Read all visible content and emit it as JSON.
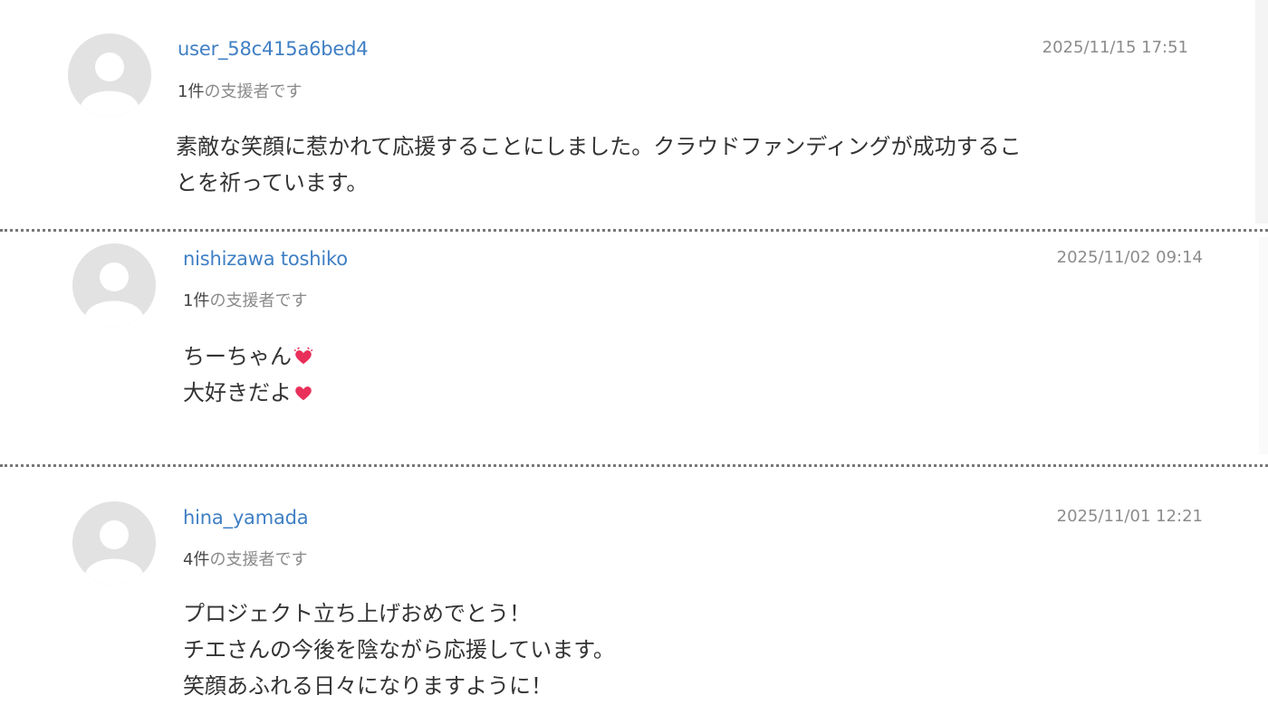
{
  "comments": [
    {
      "username": "user_58c415a6bed4",
      "supporter_count": "1件",
      "supporter_suffix": "の支援者です",
      "timestamp": "2025/11/15 17:51",
      "lines": [
        "素敵な笑顔に惹かれて応援することにしました。クラウドファンディングが成功するこ",
        "とを祈っています。"
      ]
    },
    {
      "username": "nishizawa toshiko",
      "supporter_count": "1件",
      "supporter_suffix": "の支援者です",
      "timestamp": "2025/11/02 09:14",
      "lines": [
        "ちーちゃん",
        "大好きだよ"
      ],
      "line_emoji": [
        "two-hearts-icon",
        "heart-icon"
      ]
    },
    {
      "username": "hina_yamada",
      "supporter_count": "4件",
      "supporter_suffix": "の支援者です",
      "timestamp": "2025/11/01 12:21",
      "lines": [
        "プロジェクト立ち上げおめでとう！",
        "チエさんの今後を陰ながら応援しています。",
        "笑顔あふれる日々になりますように！"
      ]
    }
  ],
  "colors": {
    "username": "#3f7fc4",
    "meta": "#8a8a8a",
    "body_text": "#333333",
    "avatar_bg": "#e2e2e2",
    "heart": "#e8305a"
  }
}
